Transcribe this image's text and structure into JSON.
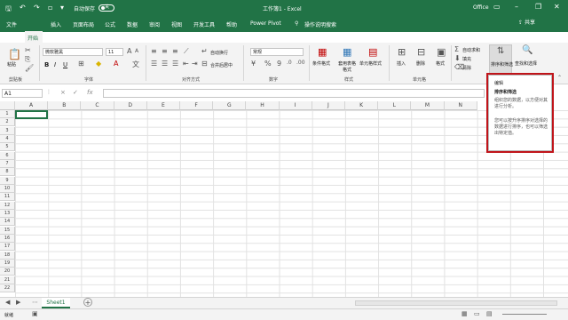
{
  "titlebar": {
    "autosave_label": "自动保存",
    "autosave_state": "关",
    "window_title": "工作簿1 - Excel",
    "office_label": "Office"
  },
  "tabs": [
    "文件",
    "开始",
    "插入",
    "页面布局",
    "公式",
    "数据",
    "审阅",
    "视图",
    "开发工具",
    "帮助",
    "Power Pivot",
    "操作说明搜索"
  ],
  "share_label": "共享",
  "ribbon": {
    "clipboard": {
      "paste": "粘贴",
      "label": "剪贴板"
    },
    "font": {
      "name": "微软雅黑",
      "size": "11",
      "label": "字体",
      "bold": "B",
      "italic": "I",
      "underline": "U"
    },
    "alignment": {
      "wrap": "自动换行",
      "merge": "合并后居中",
      "label": "对齐方式"
    },
    "number": {
      "format": "常规",
      "label": "数字"
    },
    "styles": {
      "conditional": "条件格式",
      "table": "套用表格格式",
      "cell": "单元格样式",
      "label": "样式"
    },
    "cells": {
      "insert": "插入",
      "delete": "删除",
      "format": "格式",
      "label": "单元格"
    },
    "editing": {
      "autosum": "自动求和",
      "fill": "填充",
      "clear": "清除",
      "sort": "排序和筛选",
      "find": "查找和选择",
      "label": "编辑"
    }
  },
  "formula": {
    "namebox": "A1",
    "cancel": "×",
    "enter": "✓",
    "fx": "fx"
  },
  "columns": [
    "A",
    "B",
    "C",
    "D",
    "E",
    "F",
    "G",
    "H",
    "I",
    "J",
    "K",
    "L",
    "M",
    "N"
  ],
  "rows": [
    "1",
    "2",
    "3",
    "4",
    "5",
    "6",
    "7",
    "8",
    "9",
    "10",
    "11",
    "12",
    "13",
    "14",
    "15",
    "16",
    "17",
    "18",
    "19",
    "20",
    "21",
    "22"
  ],
  "sheet": {
    "name": "Sheet1",
    "add": "+"
  },
  "status": {
    "ready": "就绪"
  },
  "tooltip": {
    "header": "编辑",
    "title": "排序和筛选",
    "line1": "组织您的数据，以方便对其进行分析。",
    "line2": "您可以按升序排序对选择的数据进行排序，也可以筛选出特定值。"
  }
}
